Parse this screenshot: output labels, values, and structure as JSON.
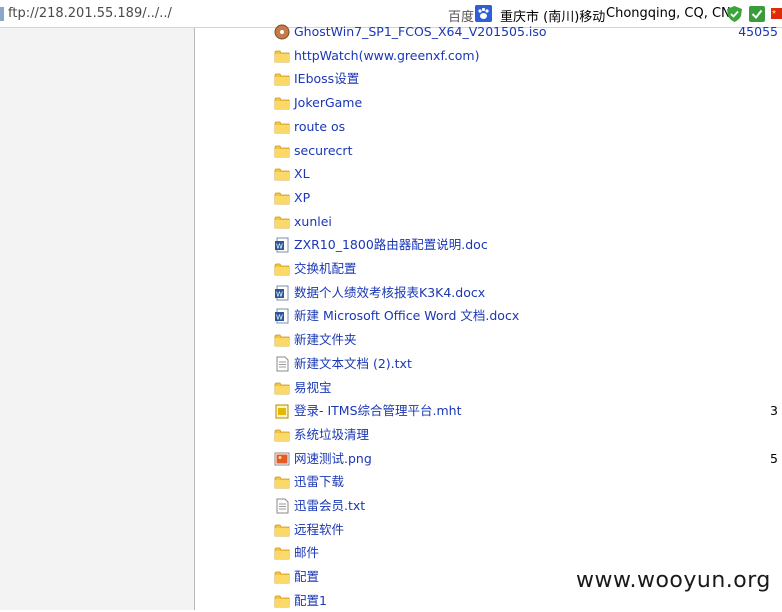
{
  "address_bar": {
    "url": "ftp://218.201.55.189/../../",
    "search_engine_label": "百度",
    "location_cn": "重庆市 (南川)移动",
    "location_en": "Chongqing, CQ, CN"
  },
  "files": [
    {
      "name": "GhostWin7_SP1_FCOS_X64_V201505.iso",
      "type": "iso",
      "size": "45055"
    },
    {
      "name": "httpWatch(www.greenxf.com)",
      "type": "folder",
      "size": ""
    },
    {
      "name": "IEboss设置",
      "type": "folder",
      "size": ""
    },
    {
      "name": "JokerGame",
      "type": "folder",
      "size": ""
    },
    {
      "name": "route os",
      "type": "folder",
      "size": ""
    },
    {
      "name": "securecrt",
      "type": "folder",
      "size": ""
    },
    {
      "name": "XL",
      "type": "folder",
      "size": ""
    },
    {
      "name": "XP",
      "type": "folder",
      "size": ""
    },
    {
      "name": "xunlei",
      "type": "folder",
      "size": ""
    },
    {
      "name": "ZXR10_1800路由器配置说明.doc",
      "type": "word",
      "size": ""
    },
    {
      "name": "交换机配置",
      "type": "folder",
      "size": ""
    },
    {
      "name": "数据个人绩效考核报表K3K4.docx",
      "type": "word",
      "size": ""
    },
    {
      "name": "新建 Microsoft Office Word 文档.docx",
      "type": "word",
      "size": ""
    },
    {
      "name": "新建文件夹",
      "type": "folder",
      "size": ""
    },
    {
      "name": "新建文本文档 (2).txt",
      "type": "text",
      "size": ""
    },
    {
      "name": "易视宝",
      "type": "folder",
      "size": ""
    },
    {
      "name": "登录- ITMS综合管理平台.mht",
      "type": "mht",
      "size": "3"
    },
    {
      "name": "系统垃圾清理",
      "type": "folder",
      "size": ""
    },
    {
      "name": "网速测试.png",
      "type": "image",
      "size": "5"
    },
    {
      "name": "迅雷下载",
      "type": "folder",
      "size": ""
    },
    {
      "name": "迅雷会员.txt",
      "type": "text",
      "size": ""
    },
    {
      "name": "远程软件",
      "type": "folder",
      "size": ""
    },
    {
      "name": "邮件",
      "type": "folder",
      "size": ""
    },
    {
      "name": "配置",
      "type": "folder",
      "size": ""
    },
    {
      "name": "配置1",
      "type": "folder",
      "size": ""
    }
  ],
  "watermark": "www.wooyun.org",
  "colors": {
    "link": "#1a37b5",
    "folder": "#f5c542",
    "left_pane": "#f3f3f3"
  }
}
